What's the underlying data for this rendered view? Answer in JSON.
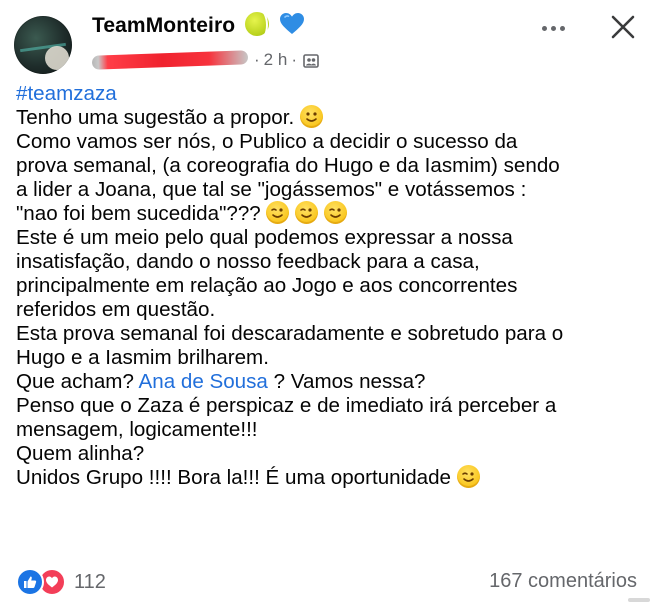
{
  "header": {
    "page_name": "TeamMonteiro",
    "name_emojis": [
      "tennis-ball",
      "blue-heart"
    ],
    "author_redacted": true,
    "time_label": "2 h",
    "separator": "·",
    "audience_icon": "group-icon",
    "more_icon": "more-options-icon",
    "close_icon": "close-icon"
  },
  "post": {
    "hashtag": "#teamzaza",
    "lines": [
      {
        "text": "Tenho uma sugestão a propor. ",
        "emojis": [
          "slight-smile"
        ]
      },
      {
        "text": "Como vamos ser nós, o Publico a decidir o sucesso da"
      },
      {
        "text": "prova semanal, (a coreografia do Hugo e da Iasmim) sendo"
      },
      {
        "text": "a lider a Joana, que tal se \"jogássemos\" e votássemos :"
      },
      {
        "text": "\"nao foi bem  sucedida\"??? ",
        "emojis": [
          "wink",
          "wink",
          "wink"
        ]
      },
      {
        "text": "Este é um meio pelo qual podemos expressar a nossa"
      },
      {
        "text": "insatisfação, dando o nosso feedback para a casa,"
      },
      {
        "text": "principalmente em relação ao Jogo e aos concorrentes"
      },
      {
        "text": "referidos em questão."
      },
      {
        "text": "Esta prova semanal foi descaradamente e sobretudo para o"
      },
      {
        "text": "Hugo e a Iasmim brilharem."
      },
      {
        "text_before": "Que acham? ",
        "mention": "Ana de Sousa",
        "text_after": " ? Vamos nessa?"
      },
      {
        "text": "Penso que o Zaza é perspicaz e de imediato irá  perceber a"
      },
      {
        "text": "mensagem,  logicamente!!!"
      },
      {
        "text": "Quem alinha?"
      },
      {
        "text": "Unidos Grupo !!!! Bora la!!! É uma oportunidade ",
        "emojis": [
          "wink"
        ]
      }
    ]
  },
  "footer": {
    "reaction_icons": [
      "like-icon",
      "love-icon"
    ],
    "reaction_count": "112",
    "comments_label": "167 comentários"
  },
  "colors": {
    "link_blue": "#216fdb",
    "meta_gray": "#65676b",
    "like_blue": "#1b74e4",
    "love_red": "#f33e58"
  }
}
